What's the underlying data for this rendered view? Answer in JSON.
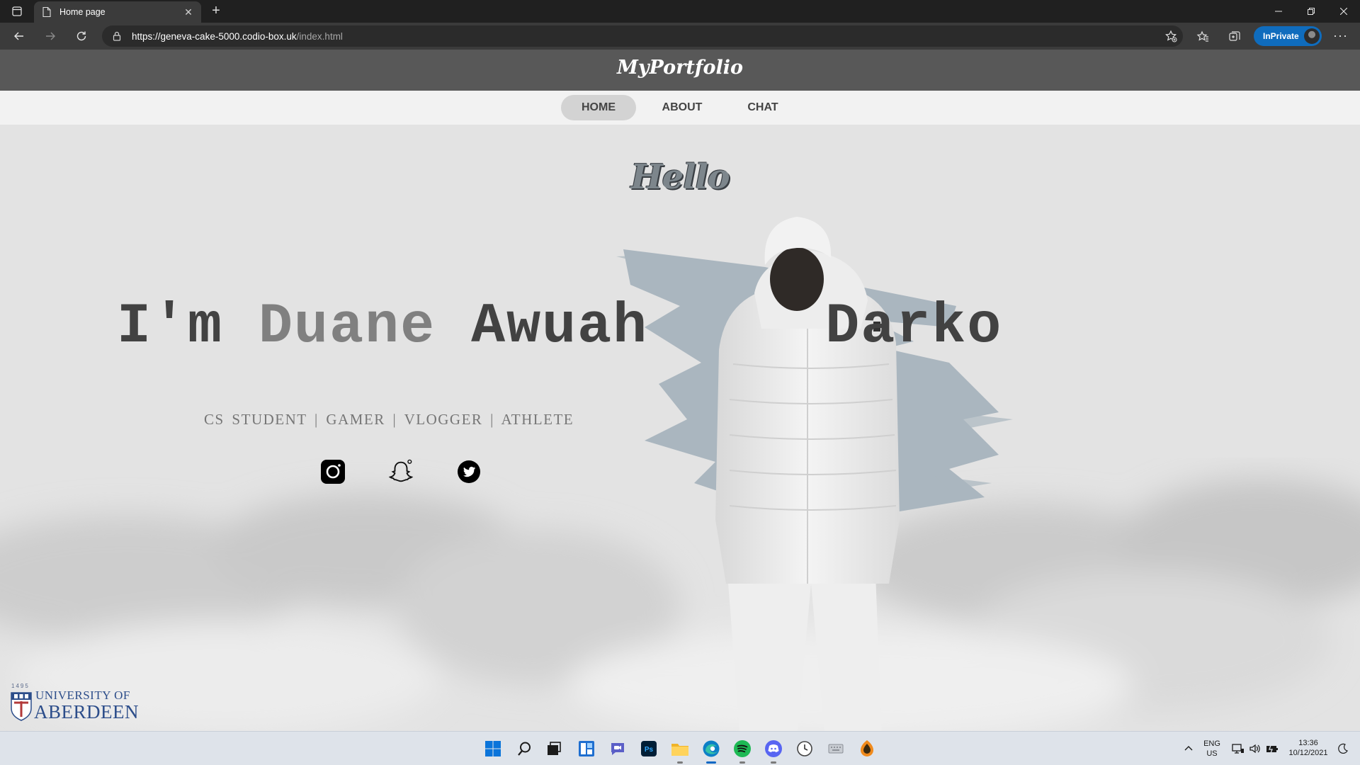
{
  "browser": {
    "tab_title": "Home page",
    "new_tab_symbol": "+",
    "url_host": "https://geneva-cake-5000.codio-box.uk",
    "url_path": "/index.html",
    "inprivate_label": "InPrivate",
    "more_symbol": "···"
  },
  "site": {
    "logo": "MyPortfolio",
    "nav": [
      {
        "label": "HOME",
        "active": true
      },
      {
        "label": "ABOUT",
        "active": false
      },
      {
        "label": "CHAT",
        "active": false
      }
    ]
  },
  "hero": {
    "greeting": "Hello",
    "headline_prefix": "I'm",
    "first_name": "Duane",
    "middle_name": "Awuah",
    "last_name": "Darko",
    "roles": "CS STUDENT  |  GAMER  |  VLOGGER  |  ATHLETE",
    "social_icons": [
      "instagram-icon",
      "snapchat-icon",
      "twitter-icon"
    ]
  },
  "footer_logo": {
    "year": "1495",
    "line1": "UNIVERSITY OF",
    "line2": "ABERDEEN"
  },
  "taskbar": {
    "language_line1": "ENG",
    "language_line2": "US",
    "time": "13:36",
    "date": "10/12/2021",
    "apps": [
      "start-icon",
      "search-icon",
      "task-view-icon",
      "widgets-icon",
      "teams-chat-icon",
      "photoshop-icon",
      "file-explorer-icon",
      "edge-icon",
      "spotify-icon",
      "discord-icon",
      "clock-icon",
      "keyboard-icon",
      "fl-studio-icon"
    ]
  },
  "colors": {
    "header_bg": "#585858",
    "nav_bg": "#f2f2f2",
    "hero_bg": "#e3e3e3",
    "headline_dark": "#424242",
    "headline_accent": "#808080",
    "inprivate_blue": "#0f6cbd",
    "university_blue": "#2c4d8a"
  }
}
